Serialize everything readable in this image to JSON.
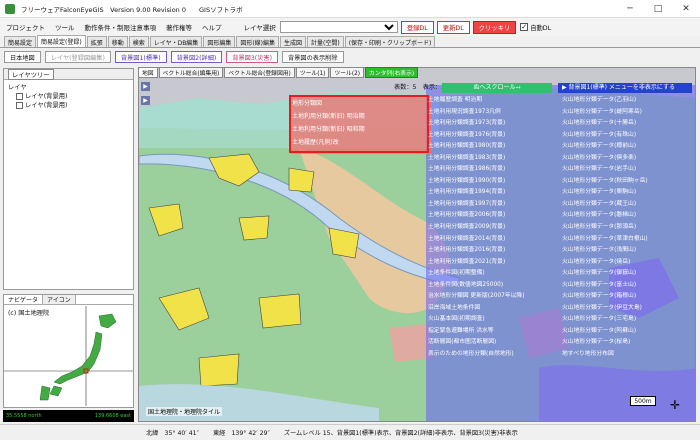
{
  "window": {
    "title": "フリーウェアFalconEyeGIS　Version 9.00 Revision 0　　GISソフトラボ"
  },
  "menu": {
    "items": [
      "プロジェクト",
      "ツール",
      "動作条件・制限注意事項",
      "著作権等",
      "ヘルプ"
    ],
    "layer_select_label": "レイヤ選択",
    "layer_select_value": "",
    "btn_register_dl": "登録DL",
    "btn_update_dl": "更新DL",
    "btn_clear": "クリッキリ",
    "auto_dl_label": "自動DL",
    "auto_dl_checked": "✓"
  },
  "tabs": [
    "簡易設定",
    "簡易設定(登録)",
    "拡張",
    "移動",
    "検索",
    "レイヤ・DB編集",
    "図形編集",
    "図形(線)編集",
    "生成図",
    "計量(空間)",
    "(保存・印刷・クリップボード)"
  ],
  "toolbar": {
    "btn_japan_map": "日本地図",
    "btn_layer_edit": "レイヤ(登録図編集)",
    "btn_bg1": "背景図1(標準)",
    "btn_bg2": "背景図2(詳細)",
    "btn_bg3": "背景図3(災害)",
    "btn_bg_list": "背景図の表示削除"
  },
  "layer_tree": {
    "tab": "レイヤツリー",
    "root": "レイヤ",
    "children": [
      "レイヤ(背景用)",
      "レイヤ(背景用)"
    ]
  },
  "navigator": {
    "tabs": [
      "ナビゲータ",
      "アイコン"
    ],
    "copyright": "(c) 国土地理院",
    "coord_left": "35.5558 north",
    "coord_right": "139.6608 east"
  },
  "map_tabs": [
    "地図",
    "ベクトル総合(編集用)",
    "ベクトル総合(登録図用)",
    "ツール(1)",
    "ツール(2)",
    "カンタ列(右表示)"
  ],
  "map": {
    "count_label": "表数：5　表示：3～5",
    "help_button": "ぬヘスクロール→",
    "hide_menu_button": "▶ 背景図1(標準) メニューを非表示にする",
    "left_items": [
      "地形分類図",
      "土地利用分類(新旧) 明治期",
      "土地利用分類(新旧) 昭和期",
      "土地履歴(凡例)改"
    ],
    "mid_items": [
      "土地履歴調査 明治期",
      "土地利用現況調査1973凡例",
      "土地利用分類調査1973(背景)",
      "土地利用分類調査1976(背景)",
      "土地利用分類調査1980(背景)",
      "土地利用分類調査1983(背景)",
      "土地利用分類調査1986(背景)",
      "土地利用分類調査1990(背景)",
      "土地利用分類調査1994(背景)",
      "土地利用分類調査1997(背景)",
      "土地利用分類調査2006(背景)",
      "土地利用分類調査2009(背景)",
      "土地利用分類調査2014(背景)",
      "土地利用分類調査2016(背景)",
      "土地利用分類調査2021(背景)",
      "土地条件図(初期整備)",
      "土地条件図(数値地図25000)",
      "治水地形分類図 更新版(2007年以降)",
      "沿岸海域土地条件図",
      "火山基本図(初期調査)",
      "指定緊急避難場所 洪水等",
      "活断層図(都市圏活断層図)",
      "表示のための地形分類(自然地形)"
    ],
    "right_items": [
      "火山地形分類データ(乙羽山)",
      "火山地形分類データ(雌阿寒岳)",
      "火山地形分類データ(十勝岳)",
      "火山地形分類データ(有珠山)",
      "火山地形分類データ(樽前山)",
      "火山地形分類データ(倶多楽)",
      "火山地形分類データ(岩手山)",
      "火山地形分類データ(秋田駒ヶ岳)",
      "火山地形分類データ(栗駒山)",
      "火山地形分類データ(蔵王山)",
      "火山地形分類データ(磐梯山)",
      "火山地形分類データ(那須岳)",
      "火山地形分類データ(草津白根山)",
      "火山地形分類データ(浅間山)",
      "火山地形分類データ(焼岳)",
      "火山地形分類データ(御嶽山)",
      "火山地形分類データ(富士山)",
      "火山地形分類データ(箱根山)",
      "火山地形分類データ(伊豆大島)",
      "火山地形分類データ(三宅島)",
      "火山地形分類データ(阿蘇山)",
      "火山地形分類データ(桜島)",
      "地すべり地形分布図"
    ],
    "scale": "500m",
    "credit": "国土地理院・地理院タイル"
  },
  "status": {
    "lat": "北緯　35° 40′ 41″",
    "lon": "東経　139° 42′ 29″",
    "zoom": "ズームレベル 15、背景図1(標準)表示、背景図2(詳細)非表示、背景図3(災害)非表示"
  },
  "colors": {
    "map_green": "#9bcf9b",
    "map_yellow": "#f2e24a",
    "map_blue_overlay": "#6d6cf0",
    "map_pink": "#f0a0a0",
    "map_water": "#c0d8f0",
    "redbox": "#e02020"
  }
}
